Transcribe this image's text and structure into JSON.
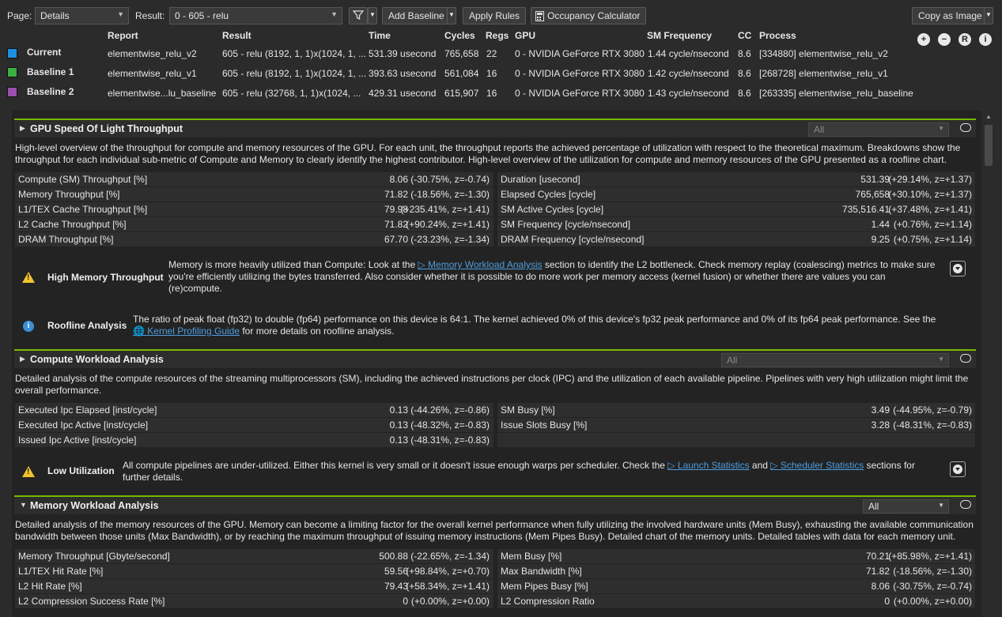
{
  "toolbar": {
    "page_label": "Page:",
    "page_value": "Details",
    "result_label": "Result:",
    "result_value": "0 -   605 - relu",
    "add_baseline": "Add Baseline",
    "apply_rules": "Apply Rules",
    "occupancy_calculator": "Occupancy Calculator",
    "copy_as_image": "Copy as Image"
  },
  "results": {
    "headers": [
      "Report",
      "Result",
      "Time",
      "Cycles",
      "Regs",
      "GPU",
      "SM Frequency",
      "CC",
      "Process"
    ],
    "rows": [
      {
        "name": "Current",
        "color": "#1e90e0",
        "report": "elementwise_relu_v2",
        "result": "605 - relu (8192, 1, 1)x(1024, 1, ...",
        "time": "531.39 usecond",
        "cycles": "765,658",
        "regs": "22",
        "gpu": "0 - NVIDIA GeForce RTX 3080",
        "smfreq": "1.44 cycle/nsecond",
        "cc": "8.6",
        "process": "[334880] elementwise_relu_v2"
      },
      {
        "name": "Baseline 1",
        "color": "#3cb043",
        "report": "elementwise_relu_v1",
        "result": "605 - relu (8192, 1, 1)x(1024, 1, ...",
        "time": "393.63 usecond",
        "cycles": "561,084",
        "regs": "16",
        "gpu": "0 - NVIDIA GeForce RTX 3080",
        "smfreq": "1.42 cycle/nsecond",
        "cc": "8.6",
        "process": "[268728] elementwise_relu_v1"
      },
      {
        "name": "Baseline 2",
        "color": "#9b4fb0",
        "report": "elementwise...lu_baseline",
        "result": "605 - relu (32768, 1, 1)x(1024, ...",
        "time": "429.31 usecond",
        "cycles": "615,907",
        "regs": "16",
        "gpu": "0 - NVIDIA GeForce RTX 3080",
        "smfreq": "1.43 cycle/nsecond",
        "cc": "8.6",
        "process": "[263335] elementwise_relu_baseline"
      }
    ]
  },
  "header_buttons": {
    "add": "+",
    "remove": "−",
    "r": "R",
    "info": "i"
  },
  "sections": {
    "sol": {
      "title": "GPU Speed Of Light Throughput",
      "filter": "All",
      "description": "High-level overview of the throughput for compute and memory resources of the GPU. For each unit, the throughput reports the achieved percentage of utilization with respect to the theoretical maximum. Breakdowns show the throughput for each individual sub-metric of Compute and Memory to clearly identify the highest contributor. High-level overview of the utilization for compute and memory resources of the GPU presented as a roofline chart.",
      "left": [
        {
          "name": "Compute (SM) Throughput [%]",
          "value": "8.06",
          "delta": "(-30.75%, z=-0.74)"
        },
        {
          "name": "Memory Throughput [%]",
          "value": "71.82",
          "delta": "(-18.56%, z=-1.30)"
        },
        {
          "name": "L1/TEX Cache Throughput [%]",
          "value": "79.98",
          "delta": "(+235.41%, z=+1.41)"
        },
        {
          "name": "L2 Cache Throughput [%]",
          "value": "71.82",
          "delta": "(+90.24%, z=+1.41)"
        },
        {
          "name": "DRAM Throughput [%]",
          "value": "67.70",
          "delta": "(-23.23%, z=-1.34)"
        }
      ],
      "right": [
        {
          "name": "Duration [usecond]",
          "value": "531.39",
          "delta": "(+29.14%, z=+1.37)"
        },
        {
          "name": "Elapsed Cycles [cycle]",
          "value": "765,658",
          "delta": "(+30.10%, z=+1.37)"
        },
        {
          "name": "SM Active Cycles [cycle]",
          "value": "735,516.41",
          "delta": "(+37.48%, z=+1.41)"
        },
        {
          "name": "SM Frequency [cycle/nsecond]",
          "value": "1.44",
          "delta": "(+0.76%, z=+1.14)"
        },
        {
          "name": "DRAM Frequency [cycle/nsecond]",
          "value": "9.25",
          "delta": "(+0.75%, z=+1.14)"
        }
      ],
      "rule1_title": "High Memory Throughput",
      "rule1_pre": "Memory is more heavily utilized than Compute: Look at the ",
      "rule1_link": "Memory Workload Analysis",
      "rule1_post": " section to identify the L2 bottleneck. Check memory replay (coalescing) metrics to make sure you're efficiently utilizing the bytes transferred. Also consider whether it is possible to do more work per memory access (kernel fusion) or whether there are values you can (re)compute.",
      "rule2_title": "Roofline Analysis",
      "rule2_pre": "The ratio of peak float (fp32) to double (fp64) performance on this device is 64:1. The kernel achieved 0% of this device's fp32 peak performance and 0% of its fp64 peak performance. See the ",
      "rule2_link": "Kernel Profiling Guide",
      "rule2_post": " for more details on roofline analysis."
    },
    "compute": {
      "title": "Compute Workload Analysis",
      "filter": "All",
      "description": "Detailed analysis of the compute resources of the streaming multiprocessors (SM), including the achieved instructions per clock (IPC) and the utilization of each available pipeline. Pipelines with very high utilization might limit the overall performance.",
      "left": [
        {
          "name": "Executed Ipc Elapsed [inst/cycle]",
          "value": "0.13",
          "delta": "(-44.26%, z=-0.86)"
        },
        {
          "name": "Executed Ipc Active [inst/cycle]",
          "value": "0.13",
          "delta": "(-48.32%, z=-0.83)"
        },
        {
          "name": "Issued Ipc Active [inst/cycle]",
          "value": "0.13",
          "delta": "(-48.31%, z=-0.83)"
        }
      ],
      "right": [
        {
          "name": "SM Busy [%]",
          "value": "3.49",
          "delta": "(-44.95%, z=-0.79)"
        },
        {
          "name": "Issue Slots Busy [%]",
          "value": "3.28",
          "delta": "(-48.31%, z=-0.83)"
        }
      ],
      "rule1_title": "Low Utilization",
      "rule1_pre": "All compute pipelines are under-utilized. Either this kernel is very small or it doesn't issue enough warps per scheduler. Check the ",
      "rule1_link1": "Launch Statistics",
      "rule1_mid": " and ",
      "rule1_link2": "Scheduler Statistics",
      "rule1_post": " sections for further details."
    },
    "memory": {
      "title": "Memory Workload Analysis",
      "filter": "All",
      "description": "Detailed analysis of the memory resources of the GPU. Memory can become a limiting factor for the overall kernel performance when fully utilizing the involved hardware units (Mem Busy), exhausting the available communication bandwidth between those units (Max Bandwidth), or by reaching the maximum throughput of issuing memory instructions (Mem Pipes Busy). Detailed chart of the memory units. Detailed tables with data for each memory unit.",
      "left": [
        {
          "name": "Memory Throughput [Gbyte/second]",
          "value": "500.88",
          "delta": "(-22.65%, z=-1.34)"
        },
        {
          "name": "L1/TEX Hit Rate [%]",
          "value": "59.56",
          "delta": "(+98.84%, z=+0.70)"
        },
        {
          "name": "L2 Hit Rate [%]",
          "value": "79.43",
          "delta": "(+58.34%, z=+1.41)"
        },
        {
          "name": "L2 Compression Success Rate [%]",
          "value": "0",
          "delta": "(+0.00%, z=+0.00)"
        }
      ],
      "right": [
        {
          "name": "Mem Busy [%]",
          "value": "70.21",
          "delta": "(+85.98%, z=+1.41)"
        },
        {
          "name": "Max Bandwidth [%]",
          "value": "71.82",
          "delta": "(-18.56%, z=-1.30)"
        },
        {
          "name": "Mem Pipes Busy [%]",
          "value": "8.06",
          "delta": "(-30.75%, z=-0.74)"
        },
        {
          "name": "L2 Compression Ratio",
          "value": "0",
          "delta": "(+0.00%, z=+0.00)"
        }
      ]
    }
  }
}
